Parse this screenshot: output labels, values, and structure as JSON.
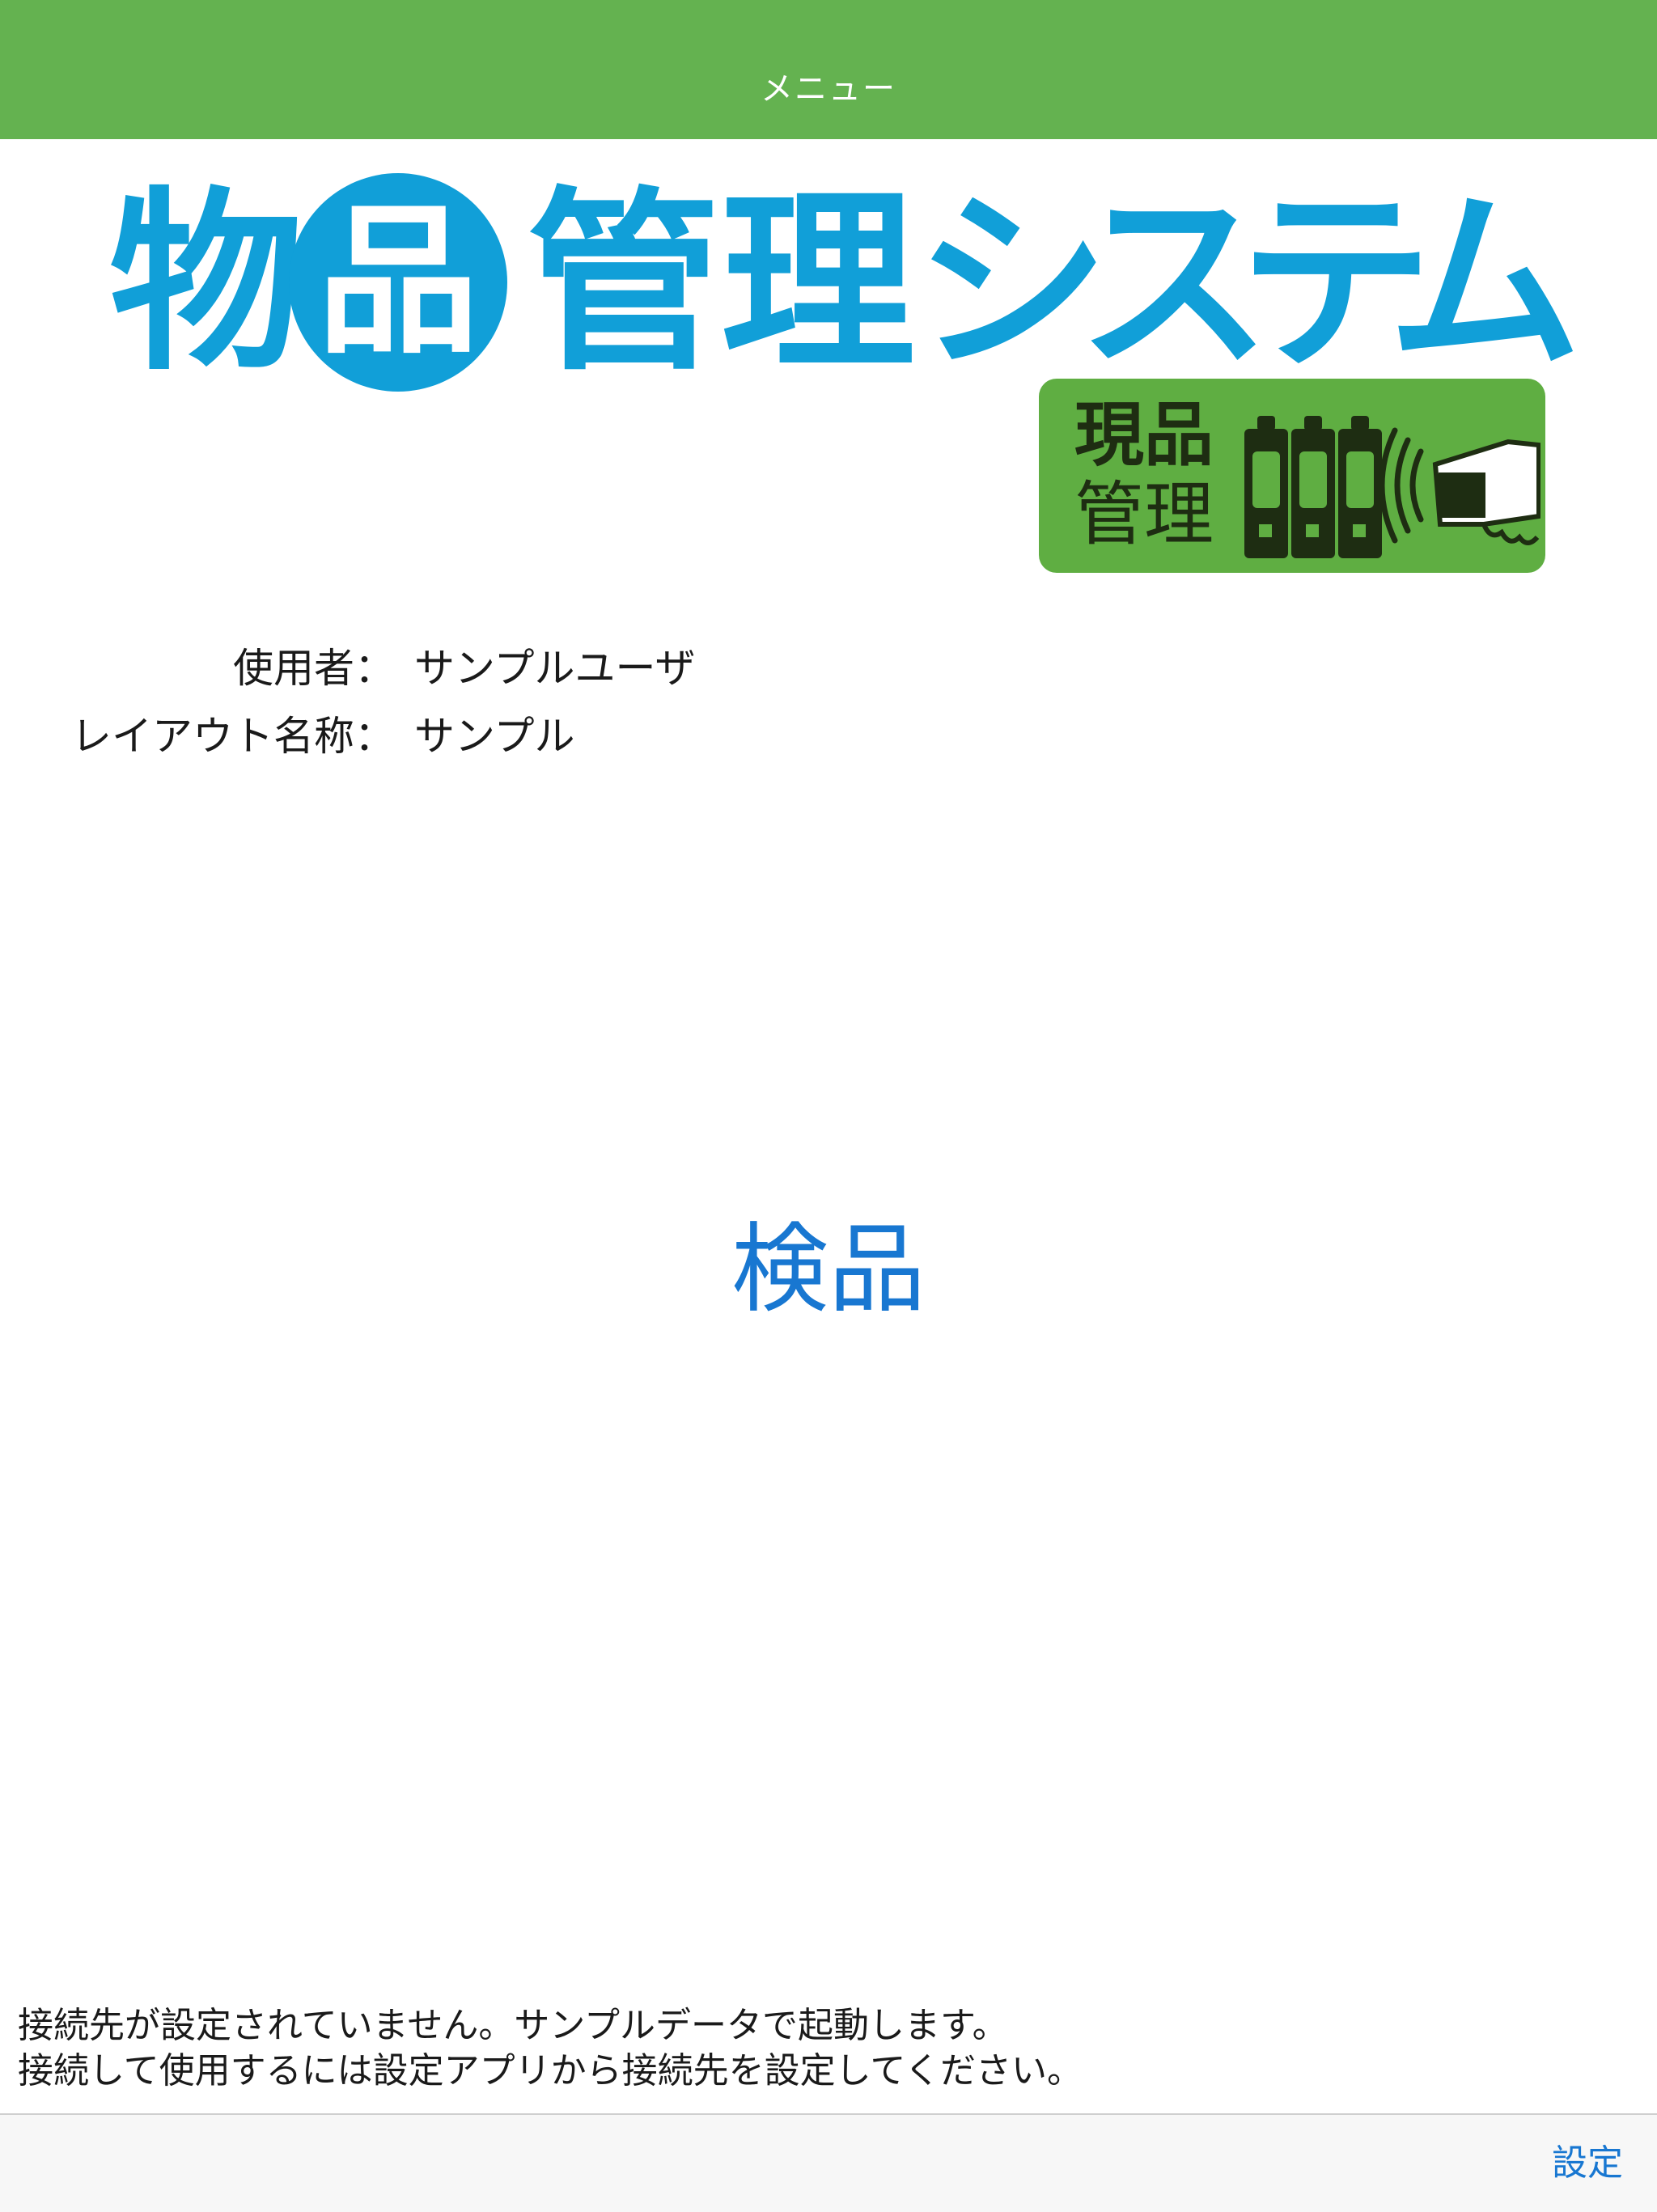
{
  "navbar": {
    "title": "メニュー"
  },
  "logo": {
    "title_chars": [
      "物",
      "品",
      "管",
      "理",
      "シ",
      "ス",
      "テ",
      "ム"
    ],
    "brand_color": "#119fd8",
    "badge": {
      "line1": "現品",
      "line2": "管理",
      "color": "#5fae42"
    }
  },
  "info": {
    "user_label": "使用者：",
    "user_value": "サンプルユーザ",
    "layout_label": "レイアウト名称：",
    "layout_value": "サンプル"
  },
  "main": {
    "inspection_button": "検品",
    "accent_color": "#1877d1"
  },
  "notice": {
    "line1": "接続先が設定されていません。サンプルデータで起動します。",
    "line2": "接続して使用するには設定アプリから接続先を設定してください。"
  },
  "toolbar": {
    "settings_label": "設定"
  },
  "colors": {
    "navbar": "#64b250",
    "toolbar": "#f7f7f7"
  }
}
